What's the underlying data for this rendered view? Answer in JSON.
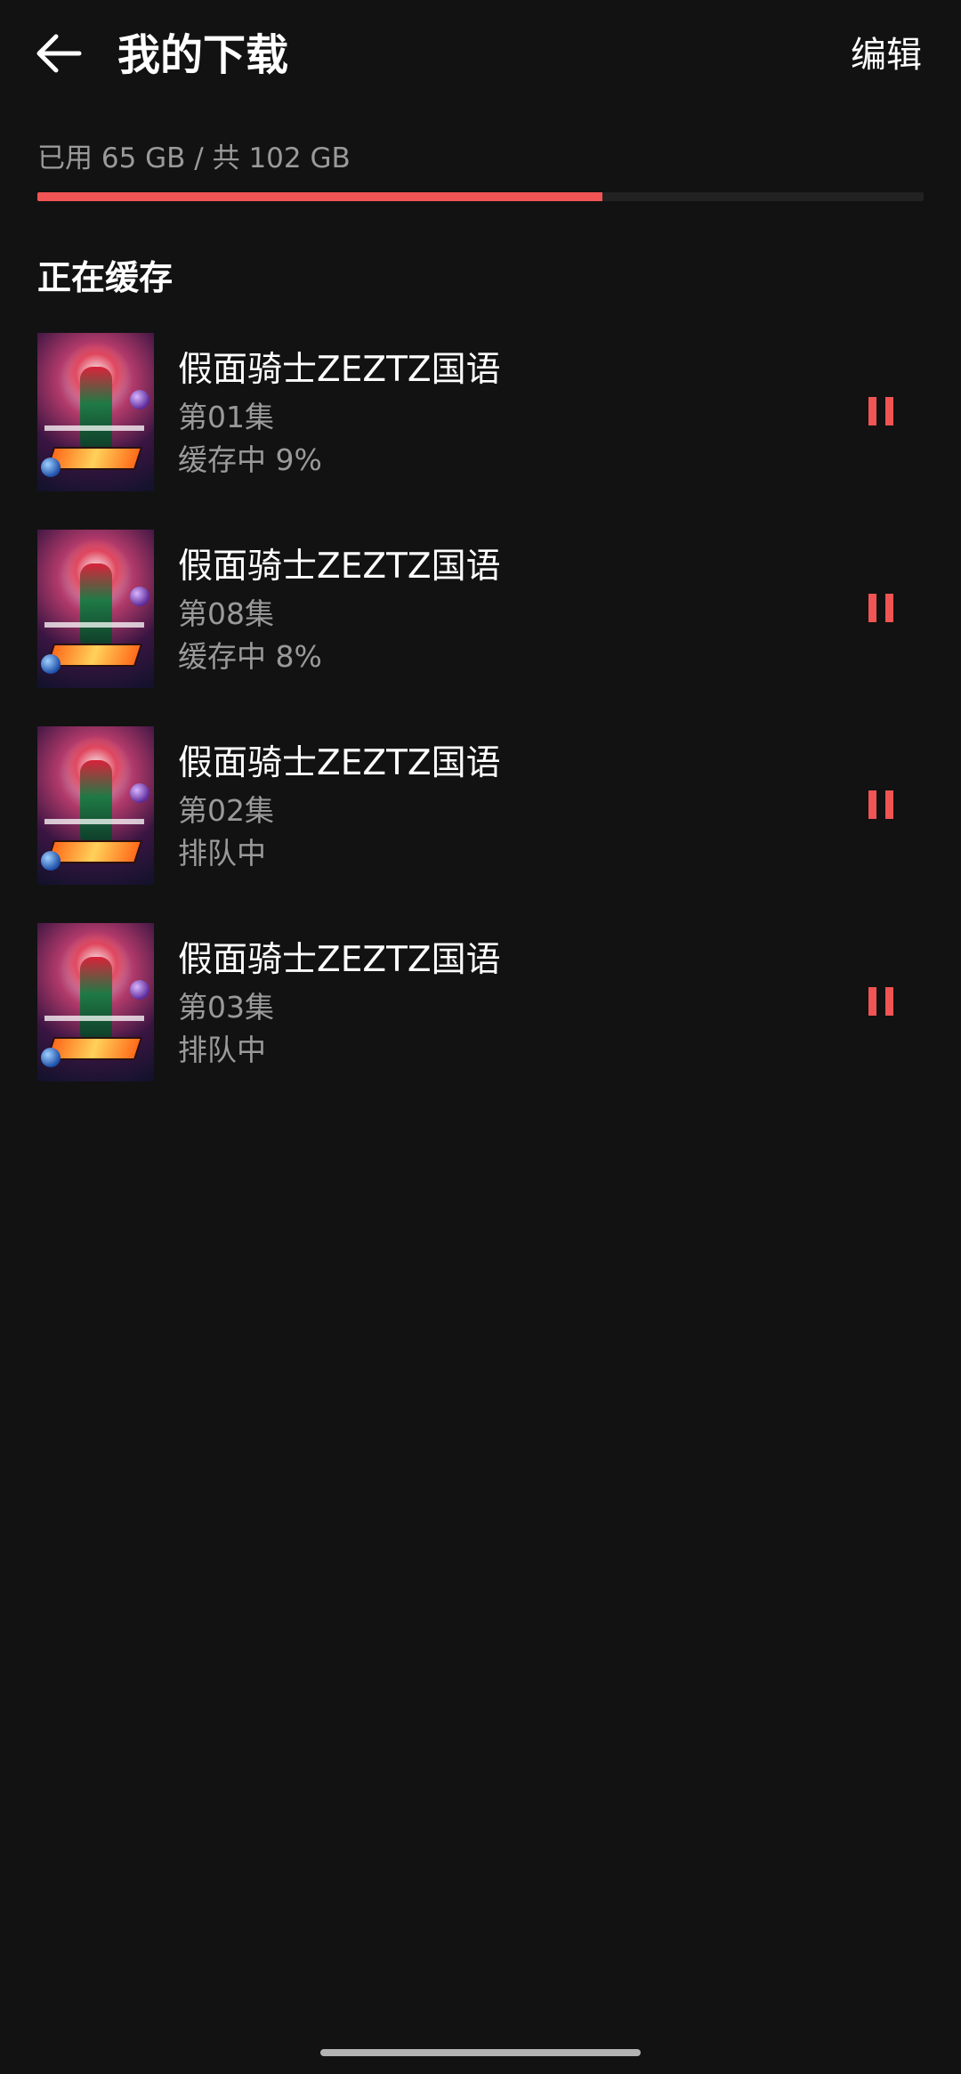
{
  "header": {
    "title": "我的下载",
    "edit_label": "编辑",
    "back_icon": "arrow-left-icon"
  },
  "storage": {
    "text": "已用 65 GB / 共 102 GB",
    "used_gb": 65,
    "total_gb": 102,
    "fill_color": "#f05454"
  },
  "section": {
    "title": "正在缓存"
  },
  "downloads": [
    {
      "title": "假面骑士ZEZTZ国语",
      "episode": "第01集",
      "status": "缓存中 9%"
    },
    {
      "title": "假面骑士ZEZTZ国语",
      "episode": "第08集",
      "status": "缓存中 8%"
    },
    {
      "title": "假面骑士ZEZTZ国语",
      "episode": "第02集",
      "status": "排队中"
    },
    {
      "title": "假面骑士ZEZTZ国语",
      "episode": "第03集",
      "status": "排队中"
    }
  ],
  "colors": {
    "background": "#121212",
    "accent": "#f05454",
    "secondary_text": "#9a9a9a"
  }
}
